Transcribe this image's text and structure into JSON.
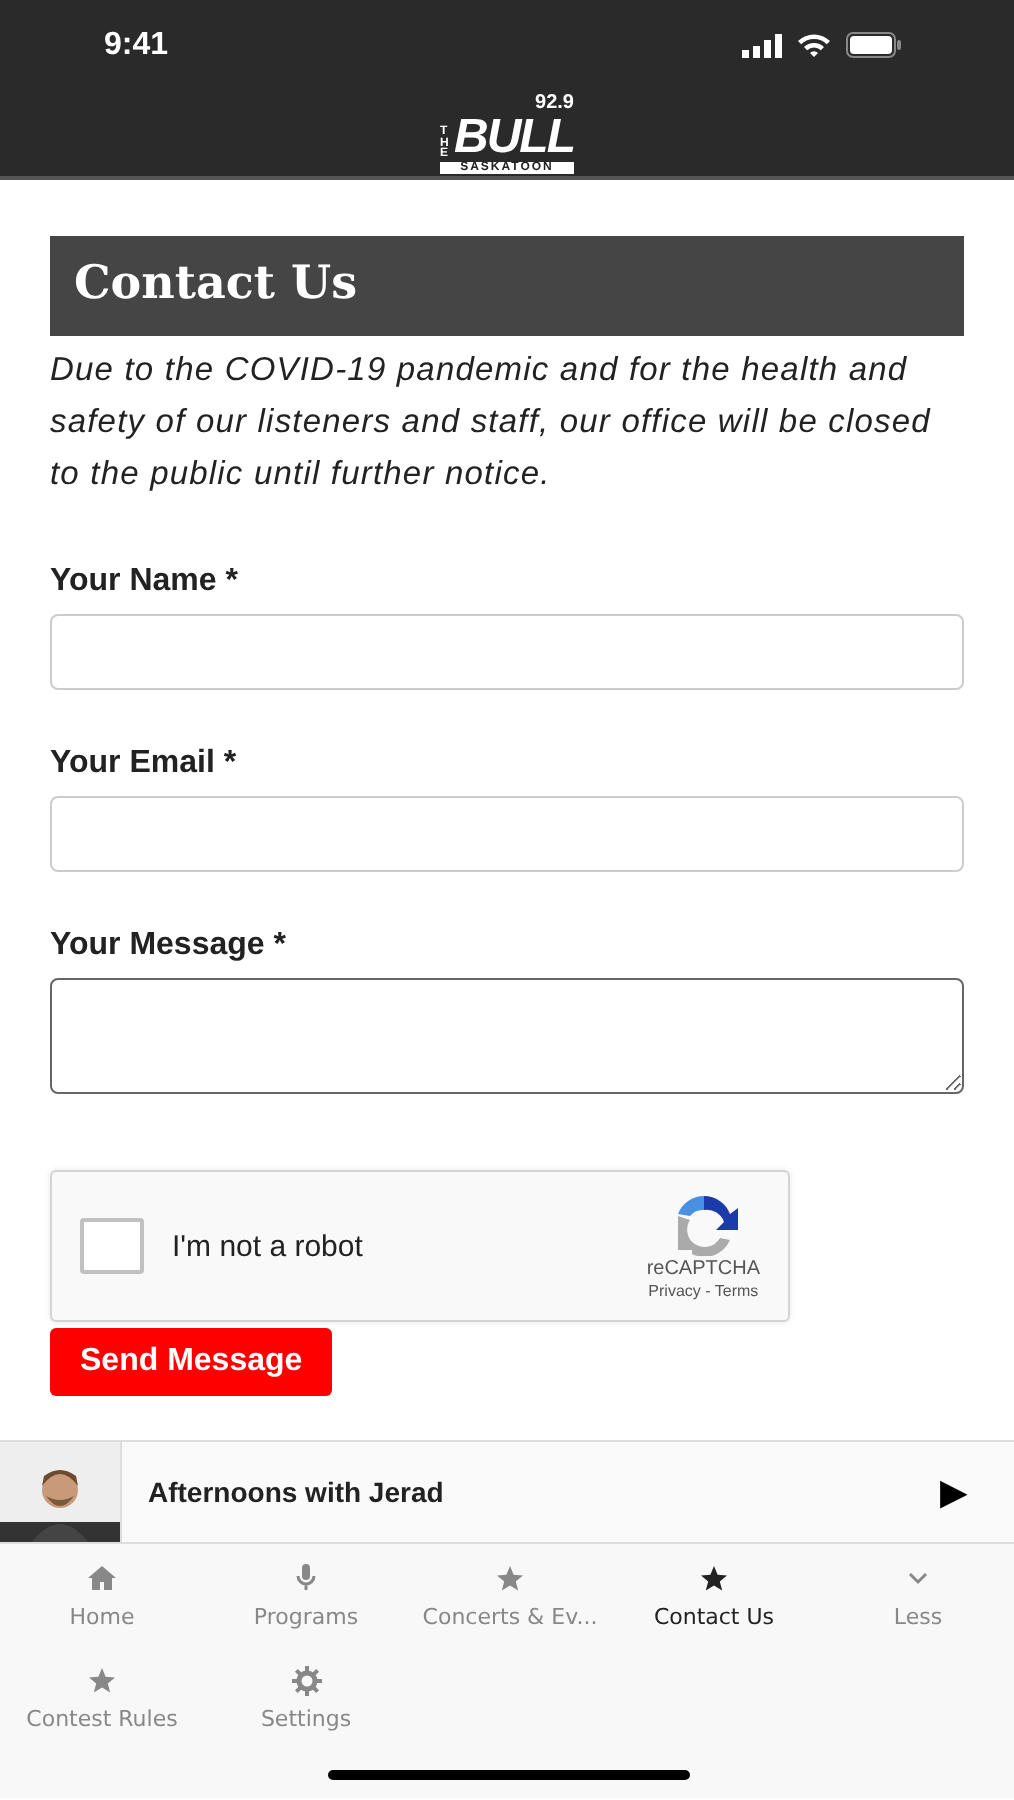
{
  "status_bar": {
    "time": "9:41"
  },
  "header": {
    "logo": {
      "frequency": "92.9",
      "prefix": "THE",
      "name": "BULL",
      "city": "SASKATOON"
    }
  },
  "page": {
    "title": "Contact Us",
    "notice": "Due to the COVID-19 pandemic and for the health and safety of our listeners and staff, our office will be closed to the public until further notice.",
    "fields": [
      {
        "label": "Your Name *",
        "kind": "line",
        "focused": false
      },
      {
        "label": "Your Email *",
        "kind": "line",
        "focused": false
      },
      {
        "label": "Your Message *",
        "kind": "area",
        "focused": true
      }
    ],
    "captcha": {
      "label": "I'm not a robot",
      "checked": false,
      "brand": "reCAPTCHA",
      "links": "Privacy - Terms"
    },
    "submit": "Send Message"
  },
  "player": {
    "show": "Afternoons with Jerad",
    "play": "▶"
  },
  "tab_bar": [
    {
      "label": "Home",
      "selected": false
    },
    {
      "label": "Programs",
      "selected": false
    },
    {
      "label": "Concerts & Ev...",
      "selected": false
    },
    {
      "label": "Contact Us",
      "selected": true
    },
    {
      "label": "Less",
      "selected": false
    },
    {
      "label": "Contest Rules",
      "selected": false
    },
    {
      "label": "Settings",
      "selected": false
    }
  ]
}
